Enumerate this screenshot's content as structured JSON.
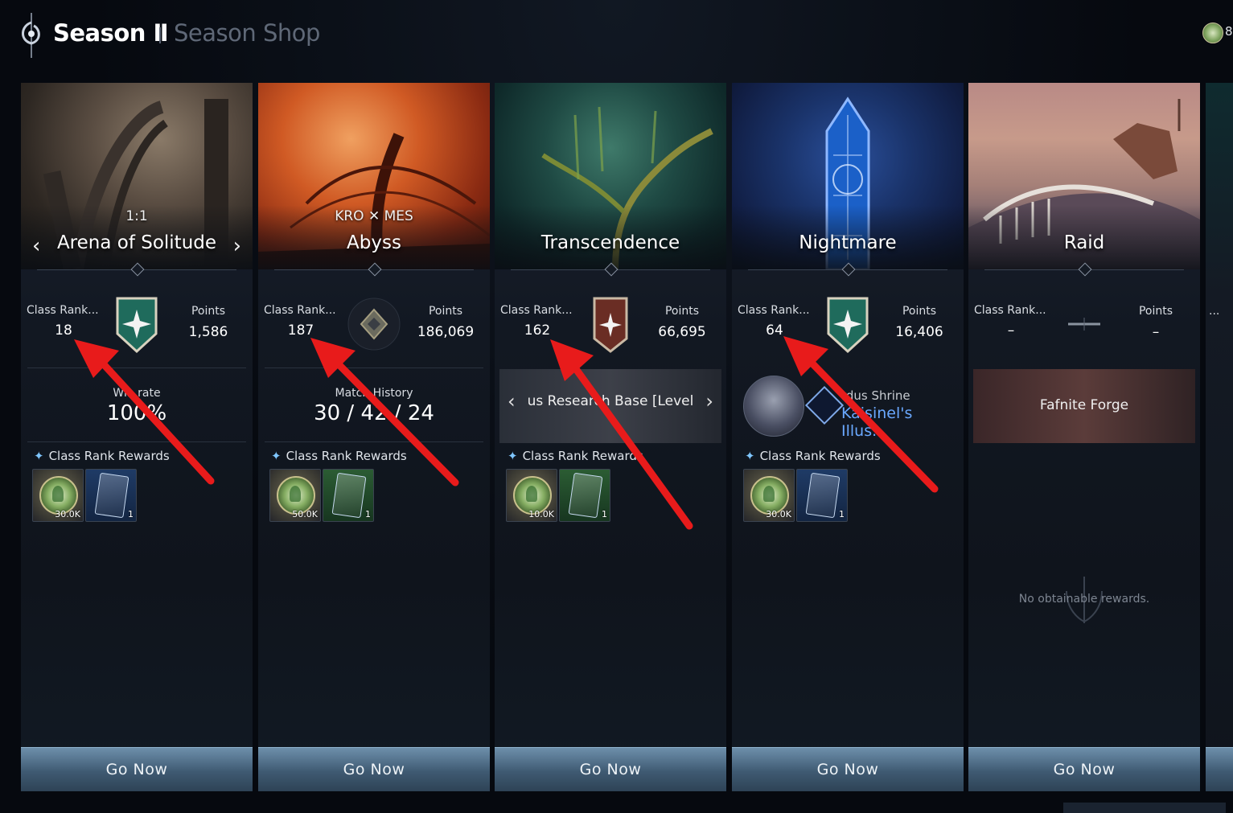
{
  "header": {
    "season_label": "Season Ⅱ",
    "shop_label": "Season Shop",
    "currency_value": "8"
  },
  "cards": [
    {
      "subtitle": "1:1",
      "title": "Arena of Solitude",
      "rank_label": "Class Rank...",
      "rank_value": "18",
      "points_label": "Points",
      "points_value": "1,586",
      "stat_label": "Win rate",
      "stat_value": "100%",
      "rewards_title": "Class Rank Rewards",
      "rewards": [
        {
          "type": "gold",
          "count": "30.0K"
        },
        {
          "type": "blue-card",
          "count": "1"
        }
      ],
      "go_label": "Go Now"
    },
    {
      "subtitle": "KRO ✕ MES",
      "title": "Abyss",
      "rank_label": "Class Rank...",
      "rank_value": "187",
      "points_label": "Points",
      "points_value": "186,069",
      "stat_label": "Match History",
      "stat_value": "30 / 42 / 24",
      "rewards_title": "Class Rank Rewards",
      "rewards": [
        {
          "type": "gold",
          "count": "50.0K"
        },
        {
          "type": "green-card",
          "count": "1"
        }
      ],
      "go_label": "Go Now"
    },
    {
      "title": "Transcendence",
      "rank_label": "Class Rank...",
      "rank_value": "162",
      "points_label": "Points",
      "points_value": "66,695",
      "dungeon": "us Research Base [Level",
      "rewards_title": "Class Rank Rewards",
      "rewards": [
        {
          "type": "gold",
          "count": "10.0K"
        },
        {
          "type": "green-card",
          "count": "1"
        }
      ],
      "go_label": "Go Now"
    },
    {
      "title": "Nightmare",
      "rank_label": "Class Rank...",
      "rank_value": "64",
      "points_label": "Points",
      "points_value": "16,406",
      "shrine_sub": "rdus Shrine",
      "shrine_title": "Kaisinel's Illus...",
      "rewards_title": "Class Rank Rewards",
      "rewards": [
        {
          "type": "gold",
          "count": "30.0K"
        },
        {
          "type": "blue-card",
          "count": "1"
        }
      ],
      "go_label": "Go Now"
    },
    {
      "title": "Raid",
      "rank_label": "Class Rank...",
      "rank_value": "–",
      "points_label": "Points",
      "points_value": "–",
      "forge": "Fafnite Forge",
      "no_rewards": "No obtainable rewards.",
      "go_label": "Go Now"
    }
  ],
  "partial_card": {
    "rank_label": "..."
  },
  "colors": {
    "accent_blue": "#6aa8ff",
    "button_top": "#6d8fab",
    "annotation_red": "#e81b1b"
  }
}
